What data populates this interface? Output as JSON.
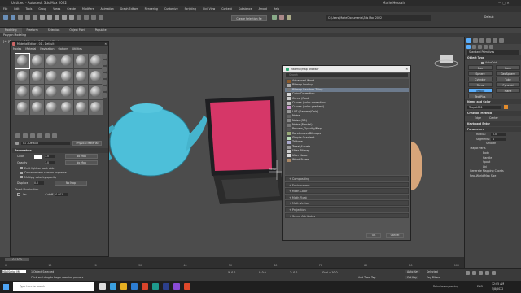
{
  "window": {
    "title": "Untitled - Autodesk 3ds Max 2022",
    "search_hint": "Type a keyword or phrase",
    "user": "Marie Hossain",
    "workspace": "Default"
  },
  "menu": [
    "File",
    "Edit",
    "Tools",
    "Group",
    "Views",
    "Create",
    "Modifiers",
    "Animation",
    "Graph Editors",
    "Rendering",
    "Customize",
    "Scripting",
    "Civil View",
    "Content",
    "Substance",
    "Arnold",
    "Help"
  ],
  "toolbar": {
    "selection_set": "Create Selection Se",
    "path": "C:\\Users\\Marie\\Documents\\3ds Max 2022"
  },
  "ribbon": {
    "tabs": [
      "Modeling",
      "Freeform",
      "Selection",
      "Object Paint",
      "Populate"
    ],
    "sub": "Polygon Modeling"
  },
  "viewport": {
    "label": "[+] [Perspective] [Standard] [Default Shading]",
    "gizmo": "Mirror"
  },
  "mat_editor": {
    "title": "Material Editor - 01 - Default",
    "menu": [
      "Modes",
      "Material",
      "Navigation",
      "Options",
      "Utilities"
    ],
    "slot_name": "01 - Default",
    "slot_type": "Physical Material",
    "parameters_title": "Parameters",
    "fields": [
      {
        "label": "Color",
        "value": "1.0",
        "map": "No Map"
      },
      {
        "label": "Opacity",
        "value": "1.0",
        "map": "No Map"
      }
    ],
    "checks": [
      "Emit light on back side",
      "Conserve/zero camera exposure",
      "Multiply color by opacity"
    ],
    "displace": {
      "label": "Displace",
      "value": "0.0",
      "map": "No Map"
    },
    "illum_title": "Direct Illumination",
    "illum": {
      "on": "On",
      "cutoff_label": "Cutoff",
      "cutoff": "0.001"
    }
  },
  "browser": {
    "title": "Material/Map Browser",
    "search_placeholder": "Search",
    "items": [
      "Advanced Wood",
      "Bitmap Lookup",
      "Bitmap Random Tiling",
      "Color Correction",
      "Curve (float)",
      "Curves (color correction)",
      "Curves (color gradient)",
      "LUT (Gamma/Gain)",
      "Noise",
      "Noise (3D)",
      "Noise (Fractal)",
      "Process_Opacity/Map",
      "RandomizedBitmaps",
      "Simple Gradient",
      "Tri-tone",
      "Tweak/Levels",
      "Uber Bitmap",
      "Uber Noise",
      "Wood Frame"
    ],
    "selected_index": 2,
    "groups": [
      "Compositing",
      "Environment",
      "Math Color",
      "Math Float",
      "Math Vector",
      "Projection",
      "Scene Attributes"
    ],
    "ok": "OK",
    "cancel": "Cancel"
  },
  "cmd_panel": {
    "category": "Standard Primitives",
    "object_type": "Object Type",
    "autogrid": "AutoGrid",
    "buttons": [
      "Box",
      "Cone",
      "Sphere",
      "GeoSphere",
      "Cylinder",
      "Tube",
      "Torus",
      "Pyramid",
      "Teapot",
      "Plane",
      "TextPlus"
    ],
    "selected_button": "Teapot",
    "name_color": "Name and Color",
    "name_value": "Teapot001",
    "creation_method": "Creation Method",
    "cm_options": [
      "Edge",
      "Center"
    ],
    "keyboard_entry": "Keyboard Entry",
    "parameters": "Parameters",
    "radius_label": "Radius:",
    "radius": "0.0",
    "segments_label": "Segments:",
    "segments": "4",
    "smooth": "Smooth",
    "teapot_parts": "Teapot Parts",
    "parts": [
      "Body",
      "Handle",
      "Spout",
      "Lid"
    ],
    "gen_coords": "Generate Mapping Coords",
    "real_world": "Real-World Map Size",
    "accent": "#5aaefc"
  },
  "timeline": {
    "frame": "0 / 100",
    "ticks": [
      "0",
      "10",
      "20",
      "30",
      "40",
      "50",
      "60",
      "70",
      "80",
      "90",
      "100"
    ]
  },
  "status": {
    "selected": "1 Object Selected",
    "hint": "Click and drag to begin creation process",
    "maxscript": "MAXScript Mi",
    "x": "X: 0.0",
    "y": "Y: 0.0",
    "z": "Z: 0.0",
    "grid": "Grid = 10.0",
    "add_time_tag": "Add Time Tag",
    "auto_key": "Auto Key",
    "set_key": "Set Key",
    "selected_label": "Selected",
    "key_filters": "Key Filters..."
  },
  "taskbar": {
    "search": "Type here to search",
    "weather": "Rainshower/coming",
    "time": "12:05 AM",
    "date": "5/8/2022",
    "lang": "ENG"
  }
}
